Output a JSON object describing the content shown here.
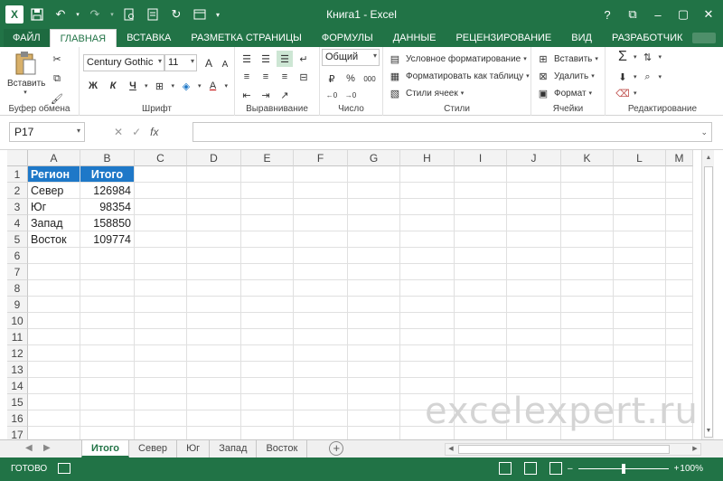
{
  "titlebar": {
    "title": "Книга1 - Excel",
    "app_icon": "X",
    "help": "?",
    "ribbon_display": "⧉",
    "minimize": "–",
    "restore": "▢",
    "close": "✕"
  },
  "tabs": [
    "ФАЙЛ",
    "ГЛАВНАЯ",
    "ВСТАВКА",
    "РАЗМЕТКА СТРАНИЦЫ",
    "ФОРМУЛЫ",
    "ДАННЫЕ",
    "РЕЦЕНЗИРОВАНИЕ",
    "ВИД",
    "РАЗРАБОТЧИК"
  ],
  "ribbon": {
    "clipboard": {
      "label": "Буфер обмена",
      "paste": "Вставить"
    },
    "font": {
      "label": "Шрифт",
      "name": "Century Gothic",
      "size": "11",
      "grow": "A",
      "shrink": "A",
      "bold": "Ж",
      "italic": "К",
      "underline": "Ч",
      "font_color": "A"
    },
    "alignment": {
      "label": "Выравнивание"
    },
    "number": {
      "label": "Число",
      "format": "Общий",
      "percent": "%",
      "thousands": "000"
    },
    "styles": {
      "label": "Стили",
      "conditional": "Условное форматирование",
      "as_table": "Форматировать как таблицу",
      "cell_styles": "Стили ячеек"
    },
    "cells": {
      "label": "Ячейки",
      "insert": "Вставить",
      "delete": "Удалить",
      "format": "Формат"
    },
    "editing": {
      "label": "Редактирование",
      "sum": "Σ"
    }
  },
  "formula_bar": {
    "name_box": "P17",
    "fx": "fx",
    "cancel": "✕",
    "enter": "✓",
    "value": ""
  },
  "columns": [
    "A",
    "B",
    "C",
    "D",
    "E",
    "F",
    "G",
    "H",
    "I",
    "J",
    "K",
    "L",
    "M"
  ],
  "rows": [
    "1",
    "2",
    "3",
    "4",
    "5",
    "6",
    "7",
    "8",
    "9",
    "10",
    "11",
    "12",
    "13",
    "14",
    "15",
    "16",
    "17"
  ],
  "table": {
    "header": [
      "Регион",
      "Итого"
    ],
    "data": [
      [
        "Север",
        "126984"
      ],
      [
        "Юг",
        "98354"
      ],
      [
        "Запад",
        "158850"
      ],
      [
        "Восток",
        "109774"
      ]
    ]
  },
  "sheets": [
    "Итого",
    "Север",
    "Юг",
    "Запад",
    "Восток"
  ],
  "status": {
    "ready": "ГОТОВО",
    "zoom": "100%"
  },
  "watermark": "excelexpert.ru",
  "colors": {
    "excel_green": "#217346",
    "header_fill": "#1e78c8"
  }
}
